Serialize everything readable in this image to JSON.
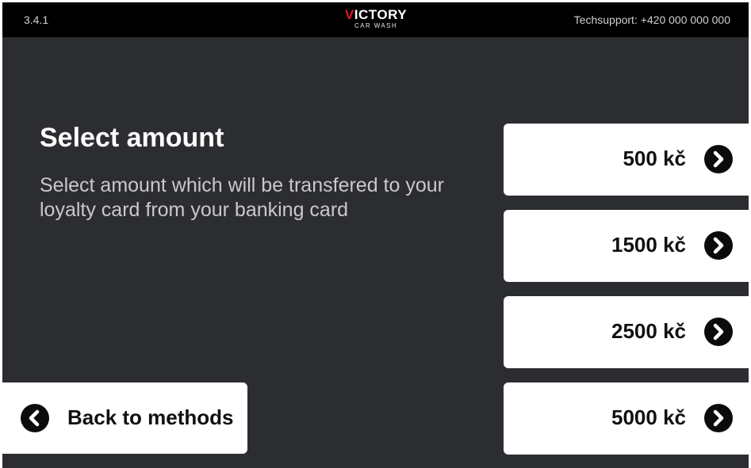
{
  "header": {
    "version": "3.4.1",
    "logo": {
      "main_first": "V",
      "main_rest": "ICTORY",
      "sub": "CAR WASH"
    },
    "support": "Techsupport: +420 000 000 000"
  },
  "main": {
    "title": "Select amount",
    "description": "Select amount which will be transfered to your loyalty card from your banking card"
  },
  "amounts": [
    {
      "label": "500 kč",
      "icon": "chevron-right-icon"
    },
    {
      "label": "1500 kč",
      "icon": "chevron-right-icon"
    },
    {
      "label": "2500 kč",
      "icon": "chevron-right-icon"
    },
    {
      "label": "5000 kč",
      "icon": "chevron-right-icon"
    }
  ],
  "back": {
    "label": "Back to methods",
    "icon": "chevron-left-icon"
  },
  "colors": {
    "background": "#2c2d31",
    "topbar": "#000000",
    "brand_accent": "#e3162b",
    "button": "#ffffff",
    "icon": "#0b0b0b"
  }
}
